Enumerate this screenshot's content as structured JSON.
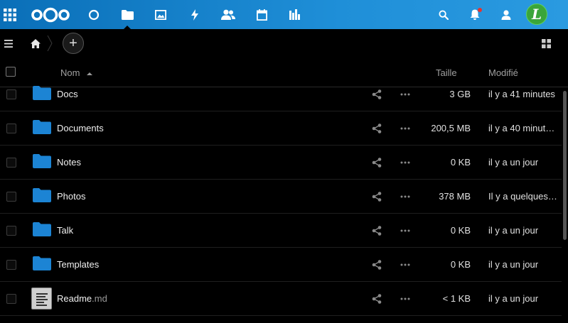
{
  "header": {
    "apps": [
      {
        "name": "dashboard"
      },
      {
        "name": "files"
      },
      {
        "name": "photos"
      },
      {
        "name": "activity"
      },
      {
        "name": "contacts"
      },
      {
        "name": "calendar"
      },
      {
        "name": "analytics"
      }
    ],
    "active_app": "files",
    "avatar_letter": "L",
    "colors": {
      "header_start": "#0a6fb8",
      "header_end": "#2a9ae0",
      "folder": "#1c84d4",
      "avatar": "#3aa53a",
      "notification_dot": "#e9322d"
    }
  },
  "toolbar": {
    "add_label": "+"
  },
  "table": {
    "columns": {
      "name": "Nom",
      "size": "Taille",
      "modified": "Modifié"
    },
    "rows": [
      {
        "name": "Docs",
        "ext": "",
        "type": "folder",
        "size": "3 GB",
        "modified": "il y a 41 minutes"
      },
      {
        "name": "Documents",
        "ext": "",
        "type": "folder",
        "size": "200,5 MB",
        "modified": "il y a 40 minut…"
      },
      {
        "name": "Notes",
        "ext": "",
        "type": "folder",
        "size": "0 KB",
        "modified": "il y a un jour"
      },
      {
        "name": "Photos",
        "ext": "",
        "type": "folder",
        "size": "378 MB",
        "modified": "Il y a quelques…"
      },
      {
        "name": "Talk",
        "ext": "",
        "type": "folder",
        "size": "0 KB",
        "modified": "il y a un jour"
      },
      {
        "name": "Templates",
        "ext": "",
        "type": "folder",
        "size": "0 KB",
        "modified": "il y a un jour"
      },
      {
        "name": "Readme",
        "ext": ".md",
        "type": "file",
        "size": "< 1 KB",
        "modified": "il y a un jour"
      }
    ]
  }
}
